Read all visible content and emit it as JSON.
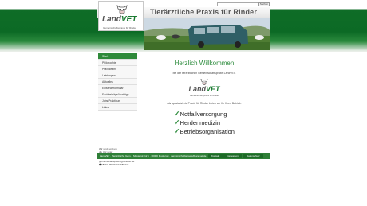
{
  "header": {
    "site_title": "Tierärztliche Praxis für Rinder",
    "search_button": "Suchen",
    "search_placeholder": ""
  },
  "logo": {
    "brand_part1": "Land",
    "brand_part2": "VET",
    "subline": "Gemeinschaftspraxis für Rinder"
  },
  "sidebar": {
    "items": [
      {
        "label": "Start",
        "active": true
      },
      {
        "label": "Philosophie"
      },
      {
        "label": "Praxisteam"
      },
      {
        "label": "Leistungen"
      },
      {
        "label": "Aktuelles"
      },
      {
        "label": "Einsendeformular"
      },
      {
        "label": "Fachbeiträge/Vorträge"
      },
      {
        "label": "Jobs/Praktikum"
      },
      {
        "label": "Links"
      }
    ],
    "contact": {
      "line1": "Wir sind rund um",
      "line2": "die Uhr unter",
      "phone": "0 21 65 / 874 96 75",
      "line4": "für Sie erreichbar.",
      "email": "gemeinschaftspraxis@landvet.de",
      "emergency": "☎ Kein Klientennotdienst"
    }
  },
  "main": {
    "welcome": "Herzlich Willkommen",
    "intro": "bei der tierärztlichen Gemeinschaftspraxis LandVET.",
    "tagline": "Als spezialisierte Praxis für Rinder bieten wir für Ihren Betrieb:",
    "features": [
      "Notfallversorgung",
      "Herdenmedizin",
      "Betriebsorganisation"
    ]
  },
  "footer": {
    "text": "LandVET · Tierärztliche Gem. · Musterstr. 12 b · 00000 Musterort · gemeinschaftspraxis@landvet.de",
    "links": [
      "Kontakt",
      "Impressum",
      "Datenschutz"
    ]
  }
}
